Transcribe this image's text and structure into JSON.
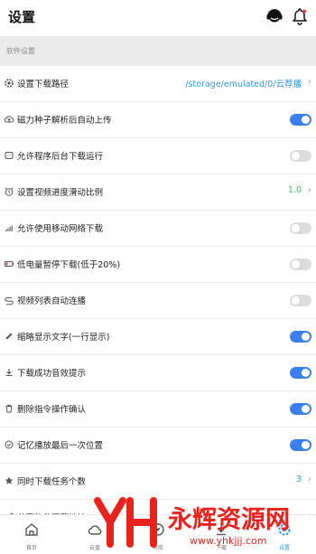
{
  "header": {
    "title": "设置"
  },
  "section": {
    "label": "软件设置"
  },
  "colors": {
    "accent": "#3a7ff0",
    "value_blue": "#2f95e8",
    "toggle_off": "#dcdcdc",
    "watermark_red": "#e8221c"
  },
  "settings": [
    {
      "label": "设置下载路径",
      "value": "/storage/emulated/0/云荐播",
      "control": "value-chevron",
      "icon": "gear-icon"
    },
    {
      "label": "磁力种子解析后自动上传",
      "control": "toggle",
      "on": true,
      "icon": "cloud-upload-icon"
    },
    {
      "label": "允许程序后台下载运行",
      "control": "toggle",
      "on": false,
      "icon": "background-icon"
    },
    {
      "label": "设置视频进度滑动比例",
      "value": "1.0",
      "control": "value-chevron",
      "value_color": "green",
      "icon": "alarm-clock-icon"
    },
    {
      "label": "允许使用移动网络下载",
      "control": "toggle",
      "on": false,
      "icon": "signal-bars-icon"
    },
    {
      "label": "低电量暂停下载(低于20%)",
      "control": "toggle",
      "on": false,
      "icon": "low-battery-icon"
    },
    {
      "label": "视频列表自动连播",
      "control": "toggle",
      "on": false,
      "icon": "loop-icon"
    },
    {
      "label": "缩略显示文字(一行显示)",
      "control": "toggle",
      "on": true,
      "icon": "pencil-icon"
    },
    {
      "label": "下载成功音效提示",
      "control": "toggle",
      "on": true,
      "icon": "download-icon"
    },
    {
      "label": "删除指令操作确认",
      "control": "toggle",
      "on": true,
      "icon": "trash-icon"
    },
    {
      "label": "记忆播放最后一次位置",
      "control": "toggle",
      "on": true,
      "icon": "check-circle-icon"
    },
    {
      "label": "同时下载任务个数",
      "value": "3",
      "control": "value-chevron",
      "icon": "star-icon"
    },
    {
      "label": "分享软件下载地址",
      "control": "chevron",
      "icon": "share-icon"
    }
  ],
  "tabs": [
    {
      "label": "首页",
      "icon": "home-icon",
      "active": false
    },
    {
      "label": "云盘",
      "icon": "cloud-icon",
      "active": false
    },
    {
      "label": "导航",
      "icon": "compass-icon",
      "active": false
    },
    {
      "label": "下载",
      "icon": "download-tab-icon",
      "active": false
    },
    {
      "label": "设置",
      "icon": "settings-tab-icon",
      "active": true
    }
  ],
  "watermark": {
    "logo_text": "YH",
    "brand": "永辉资源网",
    "url": "www.yhkjjj.com"
  }
}
